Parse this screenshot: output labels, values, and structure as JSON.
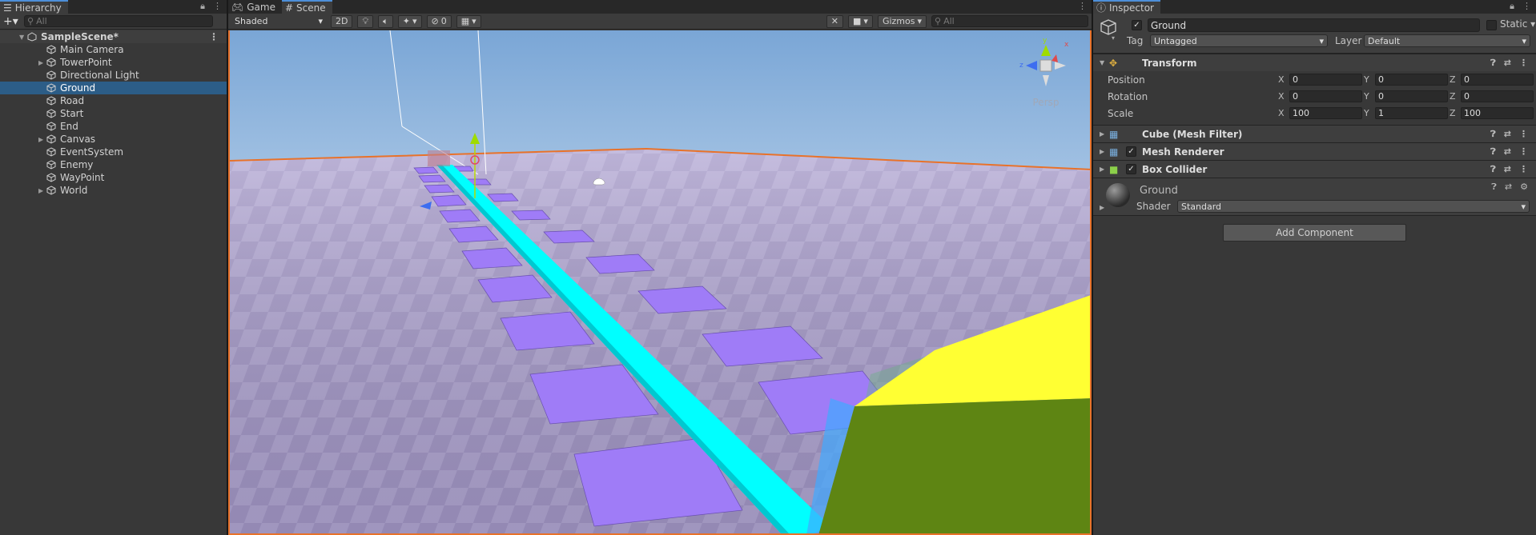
{
  "hierarchy": {
    "tab": "Hierarchy",
    "search_placeholder": "All",
    "scene": "SampleScene*",
    "items": [
      {
        "label": "Main Camera",
        "expandable": false,
        "selected": false
      },
      {
        "label": "TowerPoint",
        "expandable": true,
        "selected": false
      },
      {
        "label": "Directional Light",
        "expandable": false,
        "selected": false
      },
      {
        "label": "Ground",
        "expandable": false,
        "selected": true
      },
      {
        "label": "Road",
        "expandable": false,
        "selected": false
      },
      {
        "label": "Start",
        "expandable": false,
        "selected": false
      },
      {
        "label": "End",
        "expandable": false,
        "selected": false
      },
      {
        "label": "Canvas",
        "expandable": true,
        "selected": false
      },
      {
        "label": "EventSystem",
        "expandable": false,
        "selected": false
      },
      {
        "label": "Enemy",
        "expandable": false,
        "selected": false
      },
      {
        "label": "WayPoint",
        "expandable": false,
        "selected": false
      },
      {
        "label": "World",
        "expandable": true,
        "selected": false
      }
    ]
  },
  "scene": {
    "tabs": [
      "Game",
      "Scene"
    ],
    "active_tab": "Scene",
    "shading_mode": "Shaded",
    "toggle_2d": "2D",
    "hidden_count": "0",
    "gizmos": "Gizmos",
    "search_placeholder": "All",
    "gizmo_projection": "Persp"
  },
  "inspector": {
    "tab": "Inspector",
    "object_name": "Ground",
    "static_label": "Static",
    "tag_label": "Tag",
    "tag_value": "Untagged",
    "layer_label": "Layer",
    "layer_value": "Default",
    "transform": {
      "title": "Transform",
      "position_label": "Position",
      "rotation_label": "Rotation",
      "scale_label": "Scale",
      "position": {
        "x": "0",
        "y": "0",
        "z": "0"
      },
      "rotation": {
        "x": "0",
        "y": "0",
        "z": "0"
      },
      "scale": {
        "x": "100",
        "y": "1",
        "z": "100"
      }
    },
    "components": [
      "Cube (Mesh Filter)",
      "Mesh Renderer",
      "Box Collider"
    ],
    "material": {
      "name": "Ground",
      "shader_label": "Shader",
      "shader_value": "Standard"
    },
    "add_component": "Add Component"
  },
  "colors": {
    "selection": "#2c5d87",
    "accent": "#4d8fd9",
    "outline": "#e8722a",
    "road": "#00ffff",
    "tiles": "#9f7cf7",
    "tower": "#ffff33"
  }
}
